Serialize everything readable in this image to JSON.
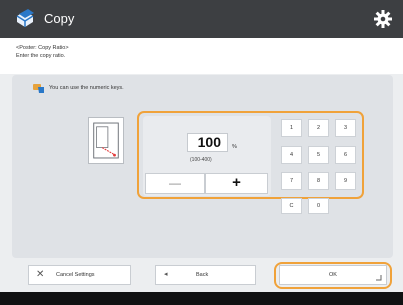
{
  "header": {
    "title": "Copy"
  },
  "instructions": {
    "line1": "<Poster: Copy Ratio>",
    "line2": "Enter the copy ratio."
  },
  "hint": "You can use the numeric keys.",
  "ratio": {
    "value": "100",
    "unit": "%",
    "range": "(100-400)"
  },
  "stepper": {
    "minus_label": "—",
    "plus_label": "+"
  },
  "keypad": {
    "keys": [
      "1",
      "2",
      "3",
      "4",
      "5",
      "6",
      "7",
      "8",
      "9",
      "C",
      "0"
    ]
  },
  "footer": {
    "cancel_label": "Cancel Settings",
    "back_label": "Back",
    "ok_label": "OK"
  },
  "colors": {
    "title_bar": "#3d3f42",
    "highlight": "#f0a23a",
    "panel": "#dfe2e6",
    "icon_blue": "#2a78c8"
  },
  "icons": {
    "app": "copy-app-icon",
    "settings": "gear-icon",
    "info": "hand-pointer-icon",
    "cancel": "close-icon",
    "back": "back-arrow-icon",
    "ok_corner": "corner-mark-icon"
  }
}
